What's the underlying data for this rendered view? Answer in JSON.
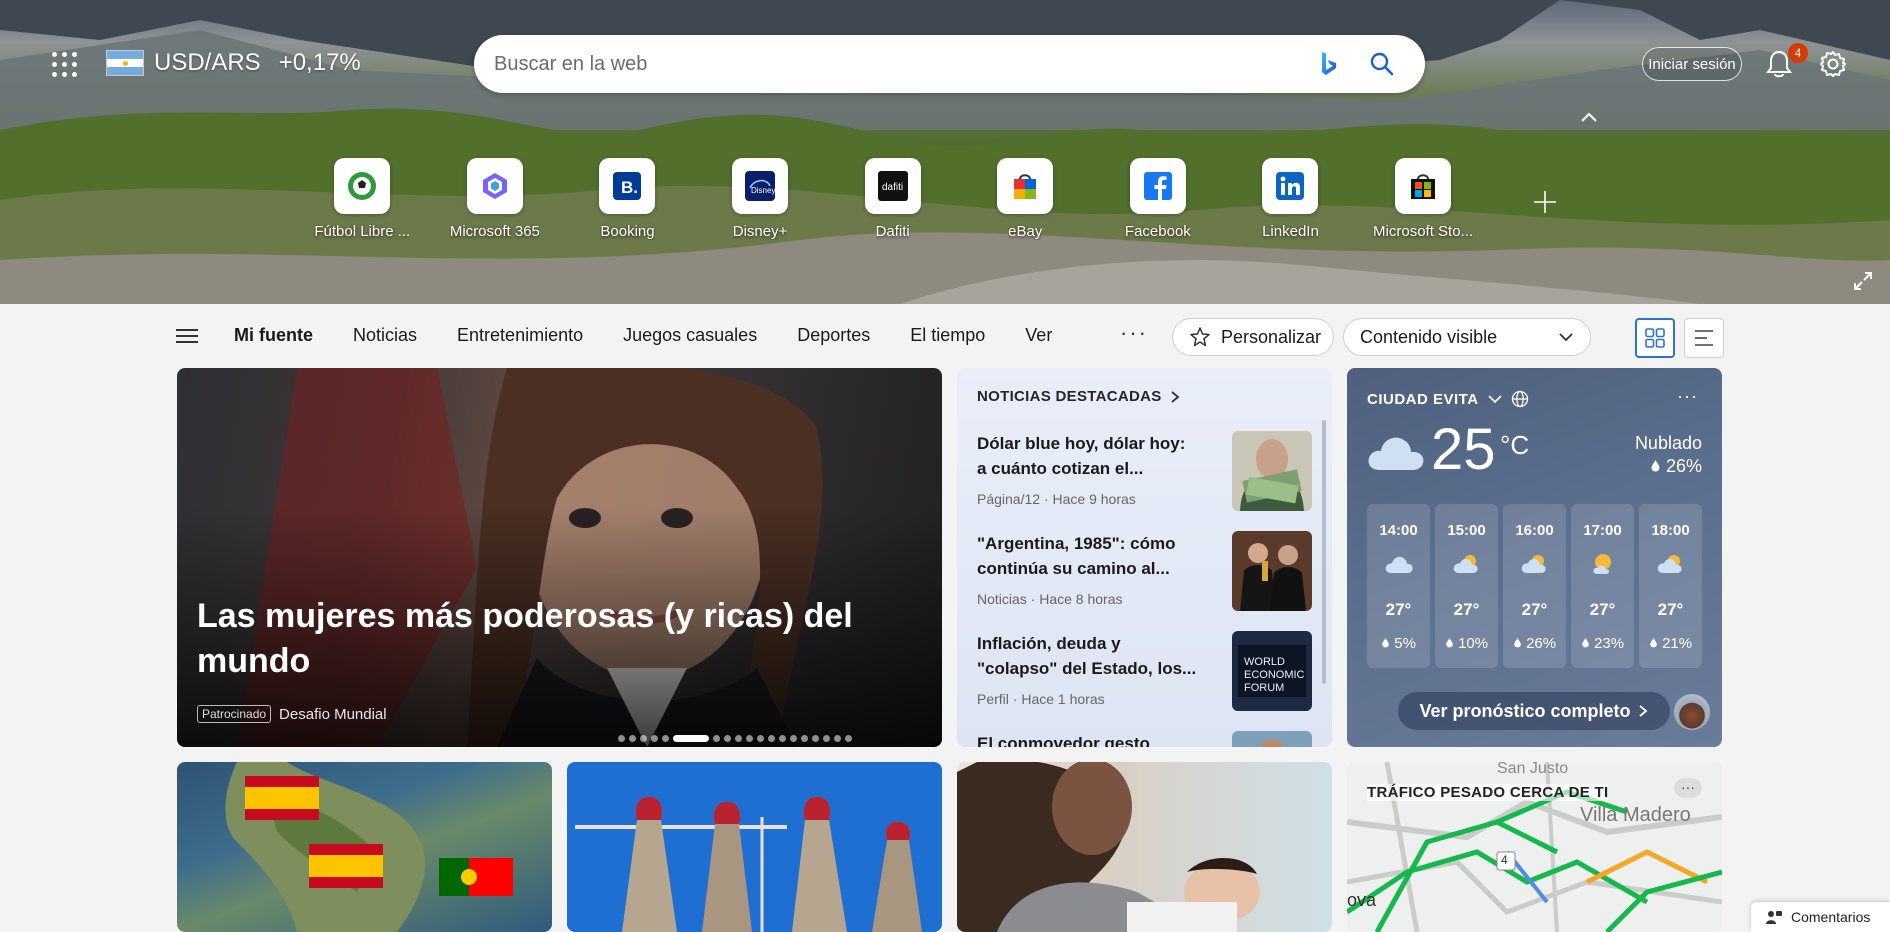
{
  "topbar": {
    "currency": {
      "pair": "USD/ARS",
      "change": "+0,17%"
    },
    "search": {
      "placeholder": "Buscar en la web"
    },
    "signin_label": "Iniciar sesión",
    "notifications_count": "4"
  },
  "quicklinks": [
    {
      "label": "Fútbol Libre ...",
      "icon": "football-icon"
    },
    {
      "label": "Microsoft 365",
      "icon": "microsoft365-icon"
    },
    {
      "label": "Booking",
      "icon": "booking-icon"
    },
    {
      "label": "Disney+",
      "icon": "disney-icon"
    },
    {
      "label": "Dafiti",
      "icon": "dafiti-icon"
    },
    {
      "label": "eBay",
      "icon": "ebay-icon"
    },
    {
      "label": "Facebook",
      "icon": "facebook-icon"
    },
    {
      "label": "LinkedIn",
      "icon": "linkedin-icon"
    },
    {
      "label": "Microsoft Sto...",
      "icon": "microsoft-store-icon"
    }
  ],
  "nav": {
    "tabs": [
      "Mi fuente",
      "Noticias",
      "Entretenimiento",
      "Juegos casuales",
      "Deportes",
      "El tiempo",
      "Ver"
    ],
    "more": "···",
    "personalize_label": "Personalizar",
    "visibility_label": "Contenido visible"
  },
  "hero_story": {
    "title": "Las mujeres más poderosas (y ricas) del mundo",
    "sponsored_tag": "Patrocinado",
    "source": "Desafio Mundial",
    "slide_count": 19,
    "active_slide": 5
  },
  "top_news": {
    "header": "NOTICIAS DESTACADAS",
    "items": [
      {
        "title": "Dólar blue hoy, dólar hoy: a cuánto cotizan el...",
        "meta": "Página/12 · Hace 9 horas"
      },
      {
        "title": "\"Argentina, 1985\": cómo continúa su camino al...",
        "meta": "Noticias · Hace 8 horas"
      },
      {
        "title": "Inflación, deuda y \"colapso\" del Estado, los...",
        "meta": "Perfil · Hace 1 horas"
      },
      {
        "title": "El conmovedor gesto que...",
        "meta": ""
      }
    ]
  },
  "weather": {
    "location": "CIUDAD EVITA",
    "temp": "25",
    "unit": "°C",
    "condition": "Nublado",
    "precip": "26%",
    "hours": [
      {
        "time": "14:00",
        "temp": "27°",
        "precip": "5%",
        "icon": "cloud-icon"
      },
      {
        "time": "15:00",
        "temp": "27°",
        "precip": "10%",
        "icon": "partly-sunny-icon"
      },
      {
        "time": "16:00",
        "temp": "27°",
        "precip": "26%",
        "icon": "partly-sunny-icon"
      },
      {
        "time": "17:00",
        "temp": "27°",
        "precip": "23%",
        "icon": "sunny-cloud-icon"
      },
      {
        "time": "18:00",
        "temp": "27°",
        "precip": "21%",
        "icon": "partly-sunny-icon"
      }
    ],
    "forecast_label": "Ver pronóstico completo"
  },
  "traffic": {
    "title": "TRÁFICO PESADO CERCA DE TI",
    "place": "Villa Madero",
    "map_labels": [
      "San Justo",
      "ova"
    ],
    "road_number": "4"
  },
  "feedback_label": "Comentarios",
  "colors": {
    "accent": "#2a72d6",
    "badge": "#d83b01",
    "weather_bg": "#5a6d8c"
  }
}
